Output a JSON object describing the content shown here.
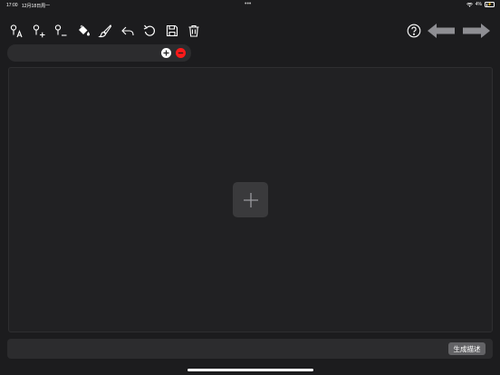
{
  "status_bar": {
    "time": "17:00",
    "date": "12月18日周一",
    "dots": "•••",
    "battery_percent": "4%",
    "icons": [
      "wifi-icon",
      "battery-charging-icon"
    ]
  },
  "toolbar": {
    "tools": [
      {
        "name": "pin-text-tool",
        "icon": "pin-a-icon"
      },
      {
        "name": "pin-add-tool",
        "icon": "pin-plus-icon"
      },
      {
        "name": "pin-remove-tool",
        "icon": "pin-minus-icon"
      },
      {
        "name": "fill-tool",
        "icon": "paint-bucket-icon"
      },
      {
        "name": "brush-tool",
        "icon": "brush-icon"
      },
      {
        "name": "undo-tool",
        "icon": "undo-icon"
      },
      {
        "name": "reset-tool",
        "icon": "rotate-icon"
      },
      {
        "name": "save-tool",
        "icon": "save-icon"
      },
      {
        "name": "delete-tool",
        "icon": "trash-icon"
      }
    ],
    "help_icon": "help-circle-icon",
    "back_icon": "arrow-left-icon",
    "forward_icon": "arrow-right-icon"
  },
  "tag_bar": {
    "add_icon": "plus-circle-icon",
    "remove_icon": "minus-circle-icon"
  },
  "canvas": {
    "add_image_icon": "plus-icon"
  },
  "bottom_bar": {
    "generate_label": "生成描述"
  },
  "colors": {
    "background": "#1c1c1e",
    "panel": "#2c2c2e",
    "remove": "#ff1a1a",
    "button": "#636366"
  }
}
